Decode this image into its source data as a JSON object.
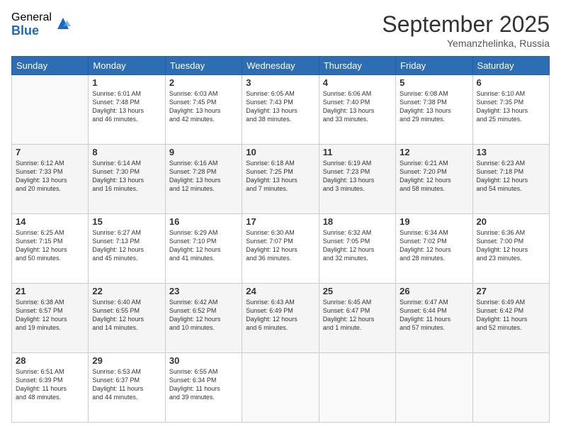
{
  "logo": {
    "general": "General",
    "blue": "Blue"
  },
  "title": "September 2025",
  "location": "Yemanzhelinka, Russia",
  "days_header": [
    "Sunday",
    "Monday",
    "Tuesday",
    "Wednesday",
    "Thursday",
    "Friday",
    "Saturday"
  ],
  "weeks": [
    [
      {
        "day": "",
        "info": ""
      },
      {
        "day": "1",
        "info": "Sunrise: 6:01 AM\nSunset: 7:48 PM\nDaylight: 13 hours\nand 46 minutes."
      },
      {
        "day": "2",
        "info": "Sunrise: 6:03 AM\nSunset: 7:45 PM\nDaylight: 13 hours\nand 42 minutes."
      },
      {
        "day": "3",
        "info": "Sunrise: 6:05 AM\nSunset: 7:43 PM\nDaylight: 13 hours\nand 38 minutes."
      },
      {
        "day": "4",
        "info": "Sunrise: 6:06 AM\nSunset: 7:40 PM\nDaylight: 13 hours\nand 33 minutes."
      },
      {
        "day": "5",
        "info": "Sunrise: 6:08 AM\nSunset: 7:38 PM\nDaylight: 13 hours\nand 29 minutes."
      },
      {
        "day": "6",
        "info": "Sunrise: 6:10 AM\nSunset: 7:35 PM\nDaylight: 13 hours\nand 25 minutes."
      }
    ],
    [
      {
        "day": "7",
        "info": "Sunrise: 6:12 AM\nSunset: 7:33 PM\nDaylight: 13 hours\nand 20 minutes."
      },
      {
        "day": "8",
        "info": "Sunrise: 6:14 AM\nSunset: 7:30 PM\nDaylight: 13 hours\nand 16 minutes."
      },
      {
        "day": "9",
        "info": "Sunrise: 6:16 AM\nSunset: 7:28 PM\nDaylight: 13 hours\nand 12 minutes."
      },
      {
        "day": "10",
        "info": "Sunrise: 6:18 AM\nSunset: 7:25 PM\nDaylight: 13 hours\nand 7 minutes."
      },
      {
        "day": "11",
        "info": "Sunrise: 6:19 AM\nSunset: 7:23 PM\nDaylight: 13 hours\nand 3 minutes."
      },
      {
        "day": "12",
        "info": "Sunrise: 6:21 AM\nSunset: 7:20 PM\nDaylight: 12 hours\nand 58 minutes."
      },
      {
        "day": "13",
        "info": "Sunrise: 6:23 AM\nSunset: 7:18 PM\nDaylight: 12 hours\nand 54 minutes."
      }
    ],
    [
      {
        "day": "14",
        "info": "Sunrise: 6:25 AM\nSunset: 7:15 PM\nDaylight: 12 hours\nand 50 minutes."
      },
      {
        "day": "15",
        "info": "Sunrise: 6:27 AM\nSunset: 7:13 PM\nDaylight: 12 hours\nand 45 minutes."
      },
      {
        "day": "16",
        "info": "Sunrise: 6:29 AM\nSunset: 7:10 PM\nDaylight: 12 hours\nand 41 minutes."
      },
      {
        "day": "17",
        "info": "Sunrise: 6:30 AM\nSunset: 7:07 PM\nDaylight: 12 hours\nand 36 minutes."
      },
      {
        "day": "18",
        "info": "Sunrise: 6:32 AM\nSunset: 7:05 PM\nDaylight: 12 hours\nand 32 minutes."
      },
      {
        "day": "19",
        "info": "Sunrise: 6:34 AM\nSunset: 7:02 PM\nDaylight: 12 hours\nand 28 minutes."
      },
      {
        "day": "20",
        "info": "Sunrise: 6:36 AM\nSunset: 7:00 PM\nDaylight: 12 hours\nand 23 minutes."
      }
    ],
    [
      {
        "day": "21",
        "info": "Sunrise: 6:38 AM\nSunset: 6:57 PM\nDaylight: 12 hours\nand 19 minutes."
      },
      {
        "day": "22",
        "info": "Sunrise: 6:40 AM\nSunset: 6:55 PM\nDaylight: 12 hours\nand 14 minutes."
      },
      {
        "day": "23",
        "info": "Sunrise: 6:42 AM\nSunset: 6:52 PM\nDaylight: 12 hours\nand 10 minutes."
      },
      {
        "day": "24",
        "info": "Sunrise: 6:43 AM\nSunset: 6:49 PM\nDaylight: 12 hours\nand 6 minutes."
      },
      {
        "day": "25",
        "info": "Sunrise: 6:45 AM\nSunset: 6:47 PM\nDaylight: 12 hours\nand 1 minute."
      },
      {
        "day": "26",
        "info": "Sunrise: 6:47 AM\nSunset: 6:44 PM\nDaylight: 11 hours\nand 57 minutes."
      },
      {
        "day": "27",
        "info": "Sunrise: 6:49 AM\nSunset: 6:42 PM\nDaylight: 11 hours\nand 52 minutes."
      }
    ],
    [
      {
        "day": "28",
        "info": "Sunrise: 6:51 AM\nSunset: 6:39 PM\nDaylight: 11 hours\nand 48 minutes."
      },
      {
        "day": "29",
        "info": "Sunrise: 6:53 AM\nSunset: 6:37 PM\nDaylight: 11 hours\nand 44 minutes."
      },
      {
        "day": "30",
        "info": "Sunrise: 6:55 AM\nSunset: 6:34 PM\nDaylight: 11 hours\nand 39 minutes."
      },
      {
        "day": "",
        "info": ""
      },
      {
        "day": "",
        "info": ""
      },
      {
        "day": "",
        "info": ""
      },
      {
        "day": "",
        "info": ""
      }
    ]
  ]
}
